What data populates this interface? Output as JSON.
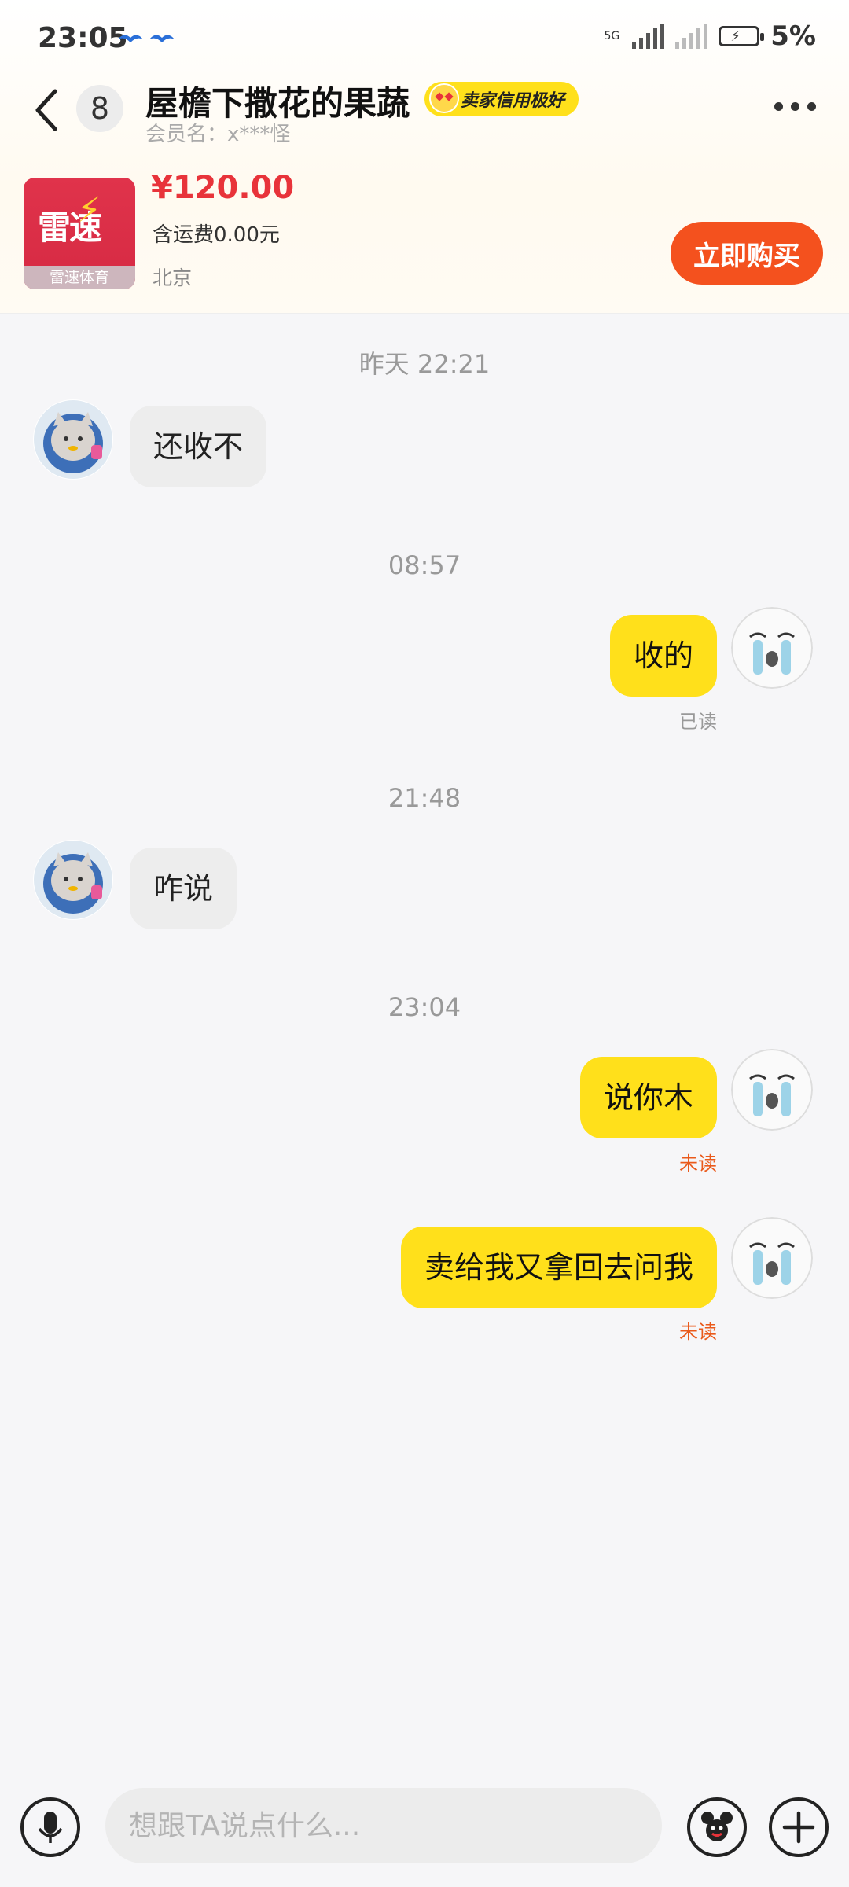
{
  "status_bar": {
    "time": "23:05",
    "network_label": "5G",
    "battery_percent": "5%"
  },
  "header": {
    "unread_count": "8",
    "title": "屋檐下撒花的果蔬",
    "credit_badge": "卖家信用极好",
    "member": "会员名：x***怪"
  },
  "product": {
    "image_text": "雷速",
    "image_caption": "雷速体育",
    "price": "¥120.00",
    "shipping": "含运费0.00元",
    "location": "北京",
    "buy_label": "立即购买"
  },
  "chat": {
    "messages": [
      {
        "timestamp": "昨天 22:21",
        "side": "in",
        "text": "还收不"
      },
      {
        "timestamp": "08:57",
        "side": "out",
        "text": "收的",
        "status": "已读"
      },
      {
        "timestamp": "21:48",
        "side": "in",
        "text": "咋说"
      },
      {
        "timestamp": "23:04",
        "side": "out",
        "text": "说你木",
        "status": "未读"
      },
      {
        "side": "out",
        "text": "卖给我又拿回去问我",
        "status": "未读"
      }
    ]
  },
  "input": {
    "placeholder": "想跟TA说点什么..."
  },
  "colors": {
    "accent_yellow": "#ffe01b",
    "buy_orange": "#f4511e",
    "price_red": "#e8333a",
    "unread_orange": "#ea5a1b"
  }
}
